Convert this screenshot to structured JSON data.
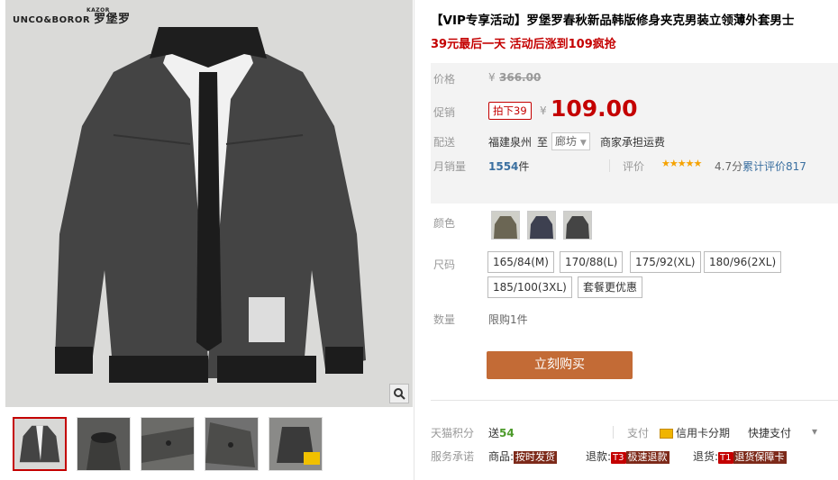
{
  "brand": {
    "logo_text": "UNCO&BOROR",
    "logo_cn": "罗堡罗",
    "logo_mark": "KAZOR"
  },
  "product": {
    "title": "【VIP专享活动】罗堡罗春秋新品韩版修身夹克男装立领薄外套男士",
    "subtitle": "39元最后一天 活动后涨到109疯抢"
  },
  "price": {
    "label": "价格",
    "yen": "¥",
    "original": "366.00",
    "promo_label": "促销",
    "promo_tag": "拍下39",
    "promo_yen": "¥",
    "promo_price": "109.00"
  },
  "shipping": {
    "label": "配送",
    "from": "福建泉州",
    "to_word": "至",
    "destination": "廊坊",
    "note": "商家承担运费"
  },
  "sales": {
    "label": "月销量",
    "count": "1554",
    "unit": "件",
    "rating_label": "评价",
    "stars": "★★★★★",
    "score": "4.7分",
    "review_text": "累计评价817"
  },
  "color": {
    "label": "颜色",
    "swatch_count": 3
  },
  "size": {
    "label": "尺码",
    "options": [
      "165/84(M)",
      "170/88(L)",
      "175/92(XL)",
      "180/96(2XL)",
      "185/100(3XL)",
      "套餐更优惠"
    ]
  },
  "quantity": {
    "label": "数量",
    "limit": "限购1件"
  },
  "buy_button": "立刻购买",
  "points": {
    "label": "天猫积分",
    "prefix": "送",
    "value": "54"
  },
  "payment": {
    "label": "支付",
    "credit": "信用卡分期",
    "quick": "快捷支付",
    "chevron": "▾"
  },
  "service": {
    "label": "服务承诺",
    "goods_label": "商品:",
    "goods_badge": "按时发货",
    "refund_label": "退款:",
    "refund_code": "T3",
    "refund_badge": "极速退款",
    "return_label": "退货:",
    "return_code": "T1",
    "return_badge": "退货保障卡"
  },
  "zoom_icon": "magnifier-icon",
  "colors": {
    "accent": "#c40000",
    "button": "#c36b36",
    "price_bg": "#f3f3f3",
    "stars": "#f5a200"
  }
}
